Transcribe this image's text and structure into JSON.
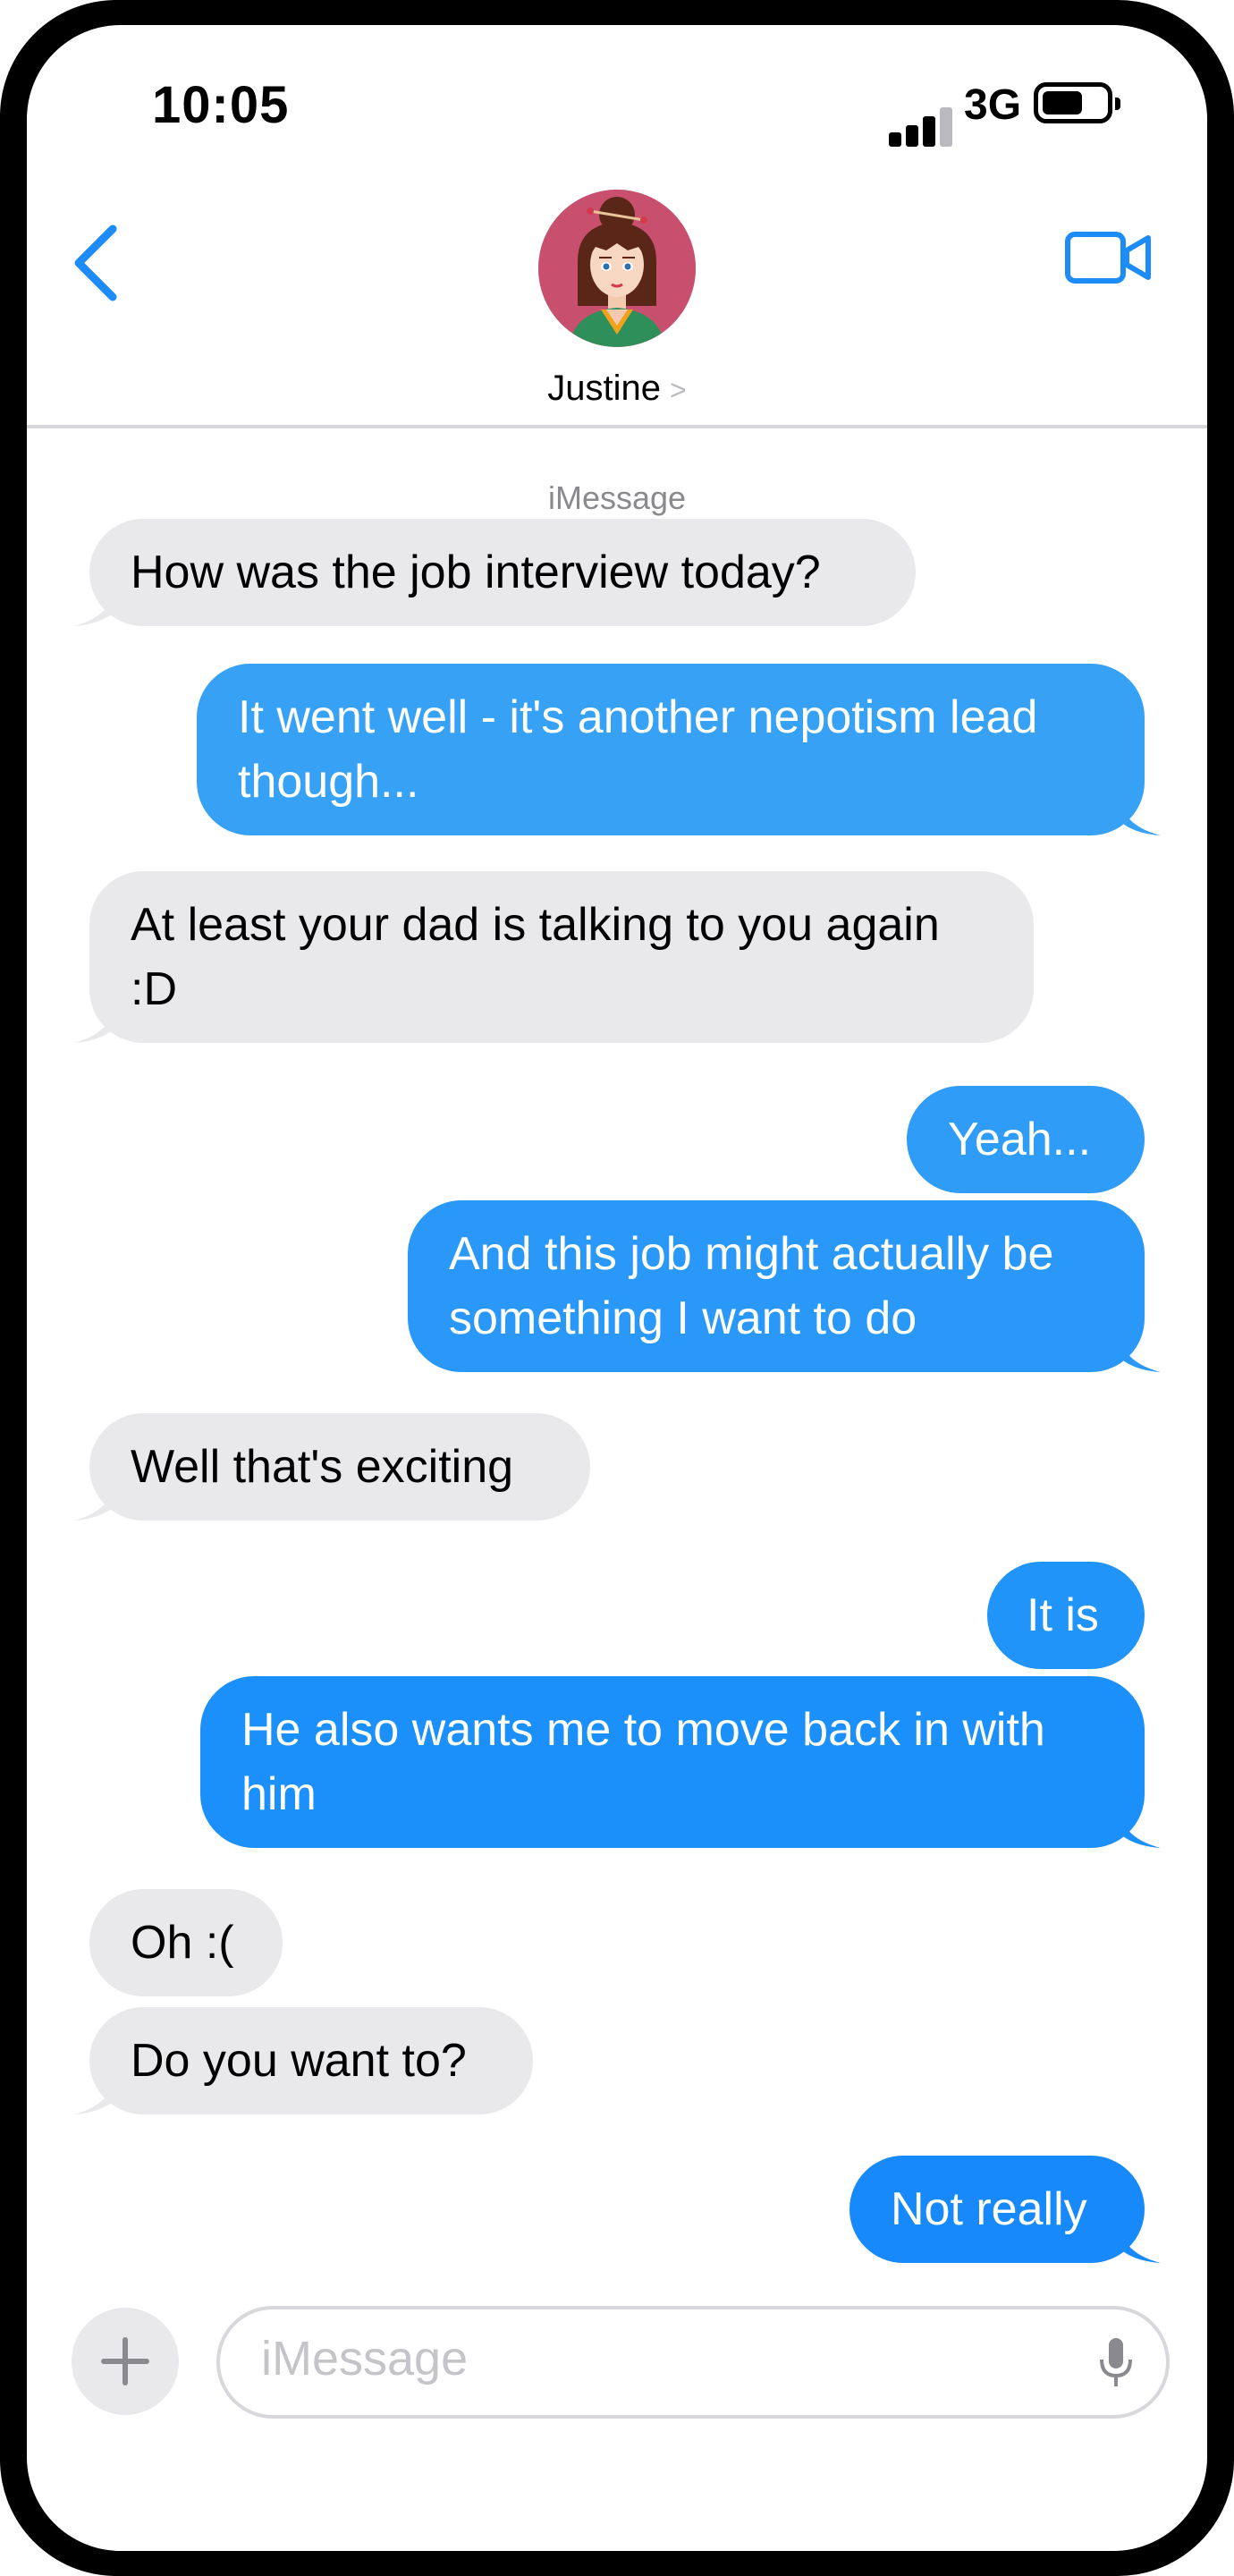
{
  "status_bar": {
    "time": "10:05",
    "network": "3G"
  },
  "header": {
    "contact_name": "Justine",
    "service_label": "iMessage"
  },
  "colors": {
    "accent": "#1d8cf8",
    "incoming_bg": "#e9e9eb",
    "outgoing_top": "#3aa3f5",
    "outgoing_bottom": "#1b8afc"
  },
  "messages": [
    {
      "dir": "in",
      "text": "How was the job interview today?"
    },
    {
      "dir": "out",
      "text": "It went well - it's another nepotism lead though..."
    },
    {
      "dir": "in",
      "text": "At least your dad is talking to you again :D"
    },
    {
      "dir": "out",
      "text": "Yeah..."
    },
    {
      "dir": "out",
      "text": "And this job might actually be something I want to do"
    },
    {
      "dir": "in",
      "text": "Well that's exciting"
    },
    {
      "dir": "out",
      "text": "It is"
    },
    {
      "dir": "out",
      "text": "He also wants me to move back in with him"
    },
    {
      "dir": "in",
      "text": "Oh :("
    },
    {
      "dir": "in",
      "text": "Do you want to?"
    },
    {
      "dir": "out",
      "text": "Not really"
    }
  ],
  "composer": {
    "placeholder": "iMessage"
  },
  "icons": {
    "back": "chevron-left-icon",
    "video": "video-camera-icon",
    "plus": "plus-icon",
    "mic": "microphone-icon"
  }
}
